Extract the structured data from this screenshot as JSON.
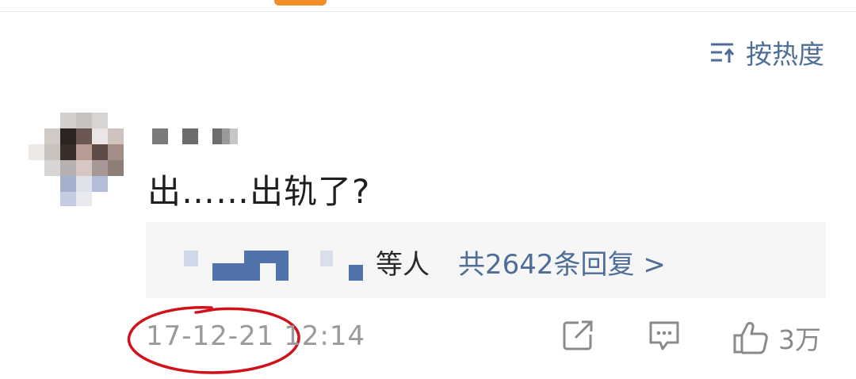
{
  "sort": {
    "label": "按热度",
    "icon": "sort-icon"
  },
  "comment": {
    "text": "出……出轨了?",
    "replies": {
      "suffix": "等人",
      "count_text": "共2642条回复 >"
    },
    "timestamp": "17-12-21 12:14",
    "actions": {
      "share_icon": "share-icon",
      "reply_icon": "comment-icon",
      "like_icon": "thumbs-up-icon",
      "like_count": "3万"
    }
  },
  "colors": {
    "accent": "#4e6e97",
    "tab_indicator": "#f28c28",
    "annotation": "#d0121b"
  }
}
